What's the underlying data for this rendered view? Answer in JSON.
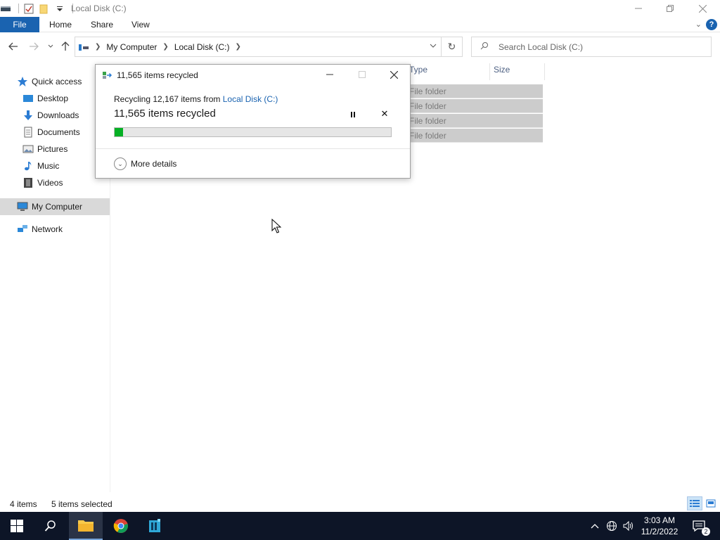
{
  "window": {
    "title": "Local Disk (C:)"
  },
  "ribbon": {
    "tabs": [
      "File",
      "Home",
      "Share",
      "View"
    ]
  },
  "address": {
    "crumbs": [
      "My Computer",
      "Local Disk (C:)"
    ],
    "search_placeholder": "Search Local Disk (C:)"
  },
  "nav": {
    "items": [
      {
        "label": "Quick access",
        "icon": "star-icon"
      },
      {
        "label": "Desktop",
        "icon": "desktop-icon"
      },
      {
        "label": "Downloads",
        "icon": "download-arrow-icon"
      },
      {
        "label": "Documents",
        "icon": "documents-icon"
      },
      {
        "label": "Pictures",
        "icon": "pictures-icon"
      },
      {
        "label": "Music",
        "icon": "music-note-icon"
      },
      {
        "label": "Videos",
        "icon": "film-icon"
      },
      {
        "label": "My Computer",
        "icon": "computer-icon",
        "selected": true
      },
      {
        "label": "Network",
        "icon": "network-icon"
      }
    ]
  },
  "file_list": {
    "columns": [
      "Type",
      "Size"
    ],
    "rows": [
      {
        "type": "File folder"
      },
      {
        "type": "File folder"
      },
      {
        "type": "File folder"
      },
      {
        "type": "File folder"
      }
    ]
  },
  "dialog": {
    "title": "11,565 items recycled",
    "line1_prefix": "Recycling 12,167 items from ",
    "line1_link": "Local Disk (C:)",
    "status": "11,565 items recycled",
    "progress_fraction": 0.03,
    "more_details": "More details"
  },
  "statusbar": {
    "item_count": "4 items",
    "selected_count": "5 items selected"
  },
  "taskbar": {
    "time": "3:03 AM",
    "date": "11/2/2022",
    "notification_count": "2"
  },
  "colors": {
    "accent": "#1a63b0",
    "progress_green": "#06b025",
    "taskbar": "#0d1527",
    "selection": "#cccccc"
  }
}
